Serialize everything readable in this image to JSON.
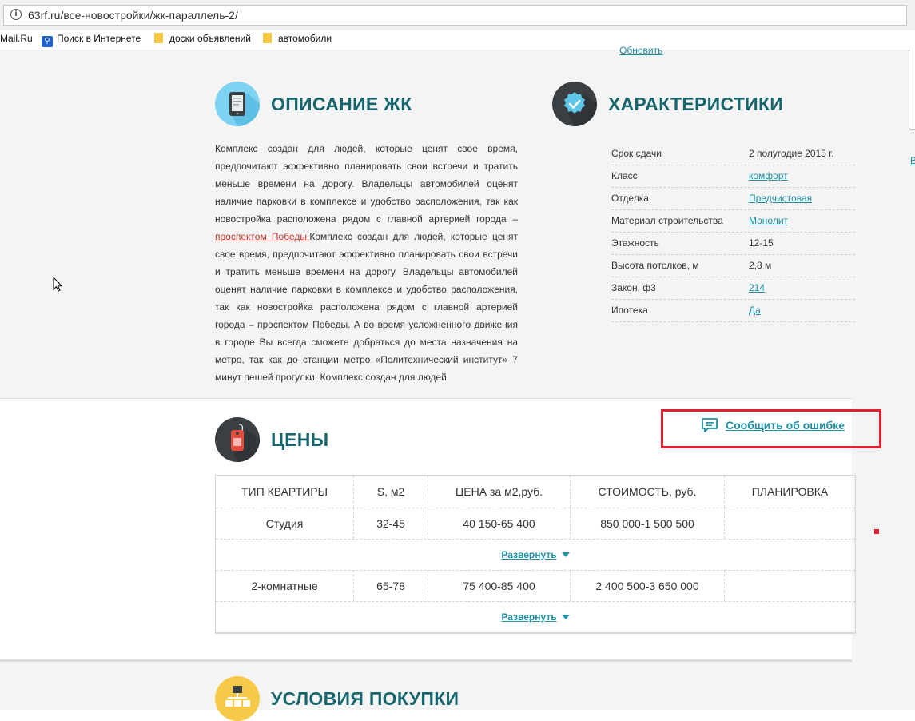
{
  "browser": {
    "url": "63rf.ru/все-новостройки/жк-параллель-2/",
    "bookmarks": [
      {
        "label": "Mail.Ru",
        "icon": "none"
      },
      {
        "label": "Поиск в Интернете",
        "icon": "search-icon"
      },
      {
        "label": "доски объявлений",
        "icon": "folder-icon"
      },
      {
        "label": "автомобили",
        "icon": "folder-icon"
      }
    ]
  },
  "page": {
    "top_link": "Обновить",
    "side_letter": "В",
    "description": {
      "title": "ОПИСАНИЕ ЖК",
      "text_before_link": "Комплекс создан для людей, которые ценят свое время, предпочитают эффективно планировать свои встречи и тратить меньше времени на дорогу. Владельцы автомобилей оценят наличие парковки в комплексе и удобство расположения, так как новостройка расположена рядом с главной артерией города – ",
      "link_text": "проспектом Победы.",
      "text_after_link": "Комплекс создан для людей, которые ценят свое время, предпочитают эффективно планировать свои встречи и тратить меньше времени на дорогу. Владельцы автомобилей оценят наличие парковки в комплексе и удобство расположения, так как новостройка расположена рядом с главной артерией города – проспектом Победы. А во время усложненного движения в городе Вы всегда сможете добраться до места назначения на метро, так как до станции метро «Политехнический институт» 7 минут пешей прогулки. Комплекс создан для людей"
    },
    "characteristics": {
      "title": "ХАРАКТЕРИСТИКИ",
      "rows": [
        {
          "label": "Срок сдачи",
          "value": "2 полугодие 2015 г.",
          "link": false
        },
        {
          "label": "Класс",
          "value": "комфорт",
          "link": true
        },
        {
          "label": "Отделка",
          "value": "Предчистовая",
          "link": true
        },
        {
          "label": "Материал строительства",
          "value": "Монолит",
          "link": true
        },
        {
          "label": "Этажность",
          "value": "12-15",
          "link": false
        },
        {
          "label": "Высота потолков, м",
          "value": "2,8 м",
          "link": false
        },
        {
          "label": "Закон, ф3",
          "value": "214",
          "link": true
        },
        {
          "label": "Ипотека",
          "value": "Да",
          "link": true
        }
      ]
    },
    "prices": {
      "title": "ЦЕНЫ",
      "report_error": "Сообщить об ошибке",
      "headers": [
        "ТИП КВАРТИРЫ",
        "S, м2",
        "ЦЕНА за м2,руб.",
        "СТОИМОСТЬ, руб.",
        "ПЛАНИРОВКА"
      ],
      "rows": [
        {
          "type": "Студия",
          "area": "32-45",
          "price_m2": "40 150-65 400",
          "cost": "850 000-1 500 500",
          "plan": ""
        },
        {
          "type": "2-комнатные",
          "area": "65-78",
          "price_m2": "75 400-85 400",
          "cost": "2 400 500-3 650 000",
          "plan": ""
        }
      ],
      "expand_label": "Развернуть"
    },
    "conditions": {
      "title": "УСЛОВИЯ ПОКУПКИ"
    }
  },
  "colors": {
    "heading": "#17666e",
    "link": "#1e8fa5",
    "highlight": "#e0212f",
    "section_bg": "#f4f4f4"
  }
}
